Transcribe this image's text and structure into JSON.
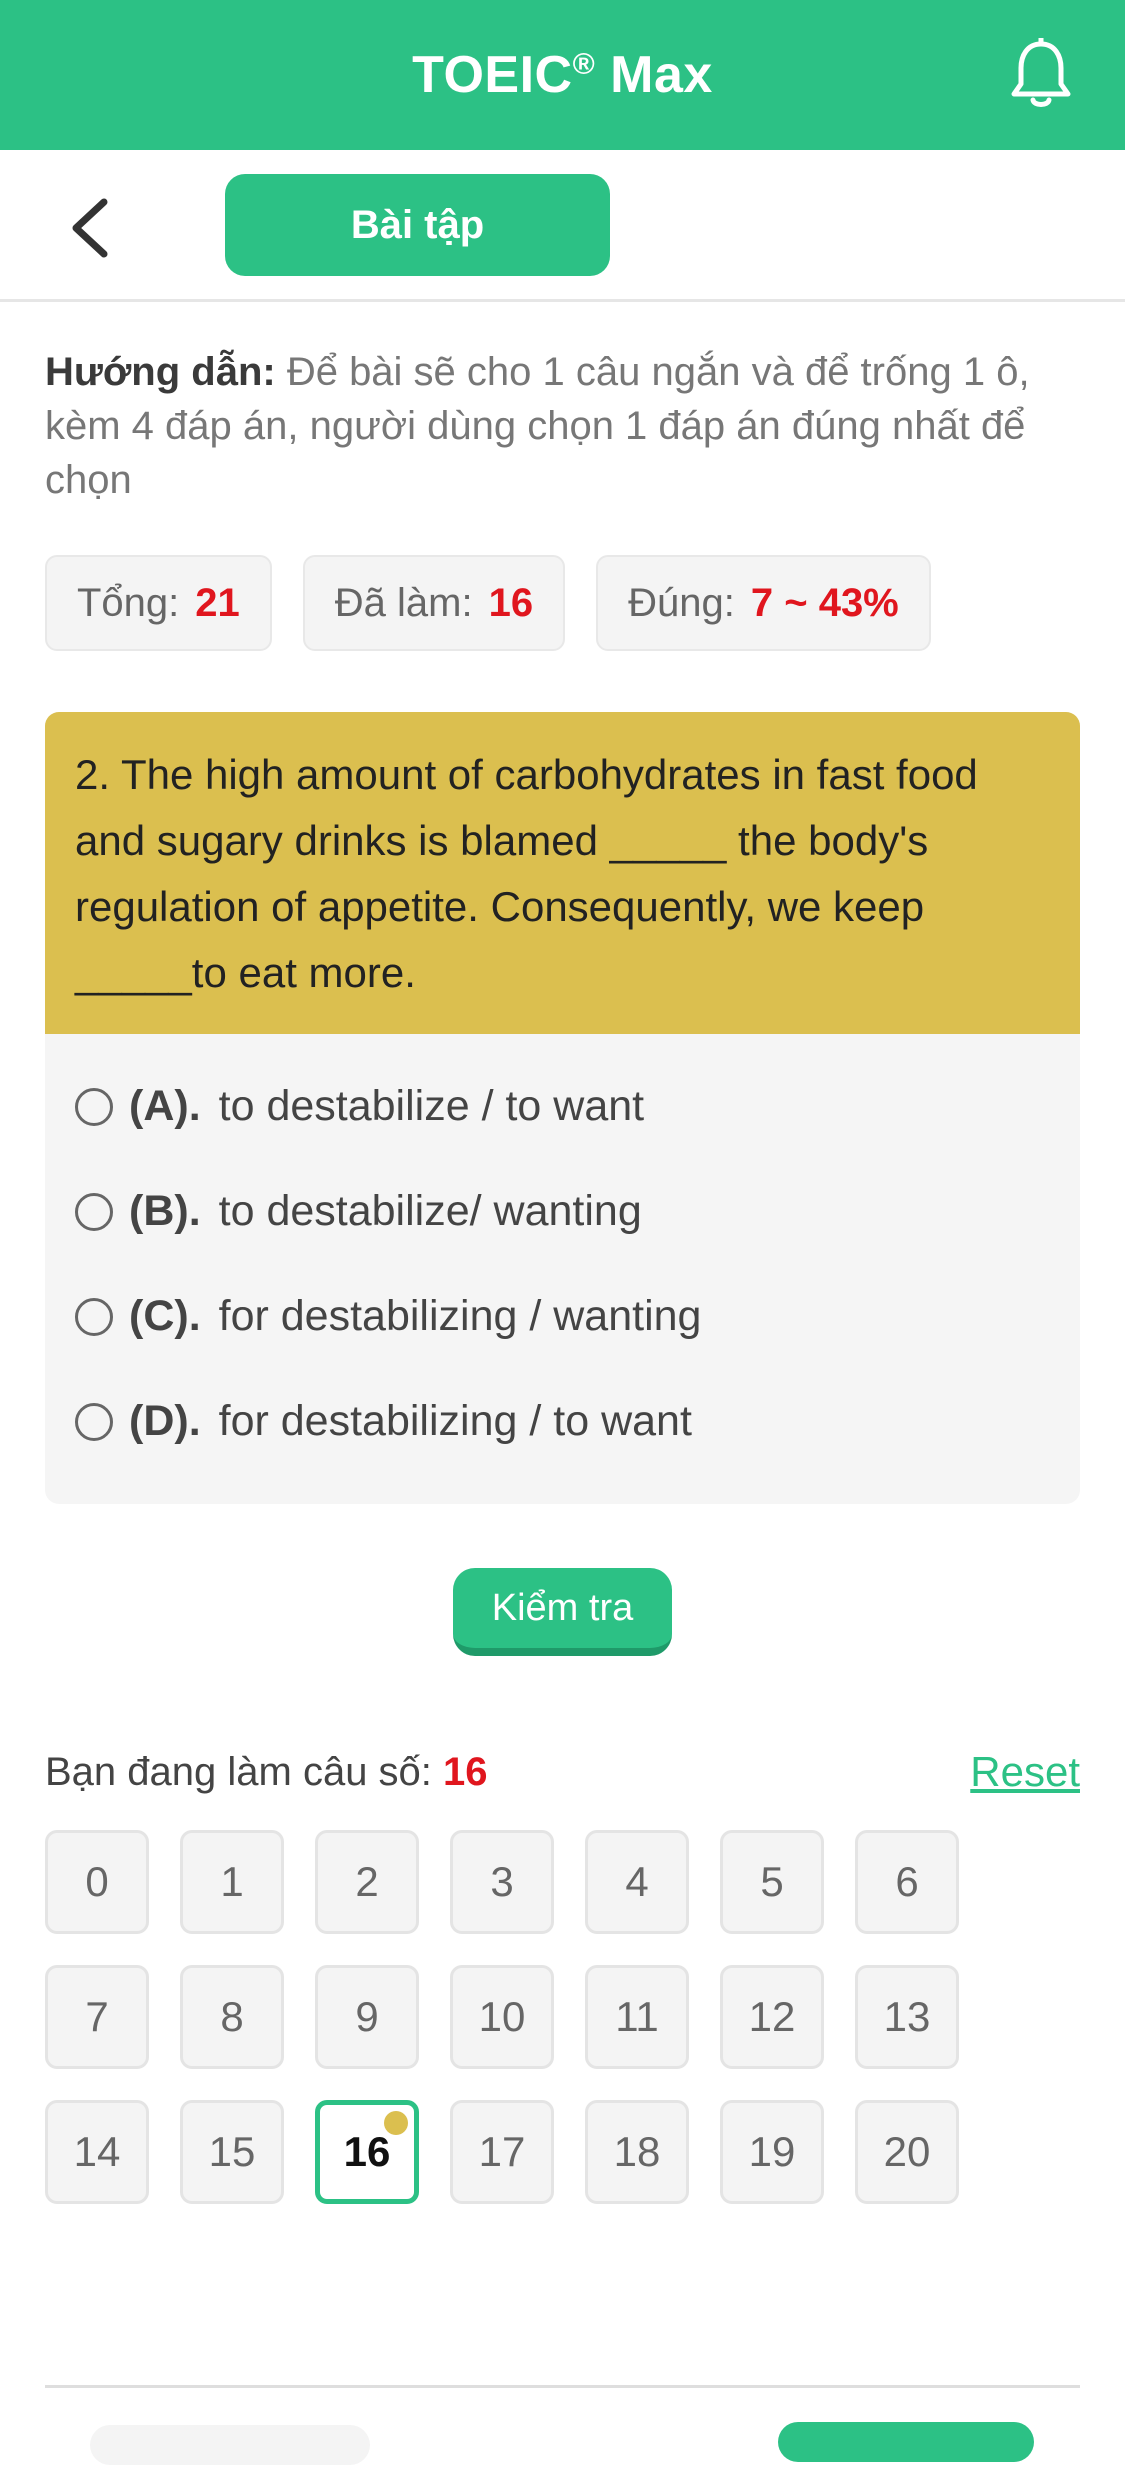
{
  "header": {
    "title": "TOEIC",
    "title_mark": "®",
    "title_suffix": " Max",
    "bell_icon": "bell-icon"
  },
  "subbar": {
    "back_icon": "chevron-left-icon",
    "tab_label": "Bài tập"
  },
  "instructions": {
    "label": "Hướng dẫn:",
    "text": " Để bài sẽ cho 1 câu ngắn và để trống 1 ô, kèm 4 đáp án, người dùng chọn 1 đáp án đúng nhất để chọn"
  },
  "stats": {
    "total_label": "Tổng:",
    "total_value": "21",
    "done_label": "Đã làm:",
    "done_value": "16",
    "correct_label": "Đúng:",
    "correct_value": "7 ~ 43%"
  },
  "question": {
    "text": "2. The high amount of carbohydrates in fast food and sugary drinks is blamed _____ the body's regulation of appetite. Consequently, we keep _____to eat more.",
    "options": [
      {
        "letter": "(A).",
        "text": "to destabilize / to want"
      },
      {
        "letter": "(B).",
        "text": "to destabilize/ wanting"
      },
      {
        "letter": "(C).",
        "text": "for destabilizing / wanting"
      },
      {
        "letter": "(D).",
        "text": "for destabilizing / to want"
      }
    ]
  },
  "check_button": "Kiểm tra",
  "progress": {
    "label": "Bạn đang làm câu số: ",
    "current": "16",
    "reset": "Reset"
  },
  "grid": {
    "numbers": [
      "0",
      "1",
      "2",
      "3",
      "4",
      "5",
      "6",
      "7",
      "8",
      "9",
      "10",
      "11",
      "12",
      "13",
      "14",
      "15",
      "16",
      "17",
      "18",
      "19",
      "20"
    ],
    "active": "16"
  },
  "colors": {
    "primary": "#2cc185",
    "question_bg": "#dbbf4f",
    "accent_red": "#e0161e"
  }
}
